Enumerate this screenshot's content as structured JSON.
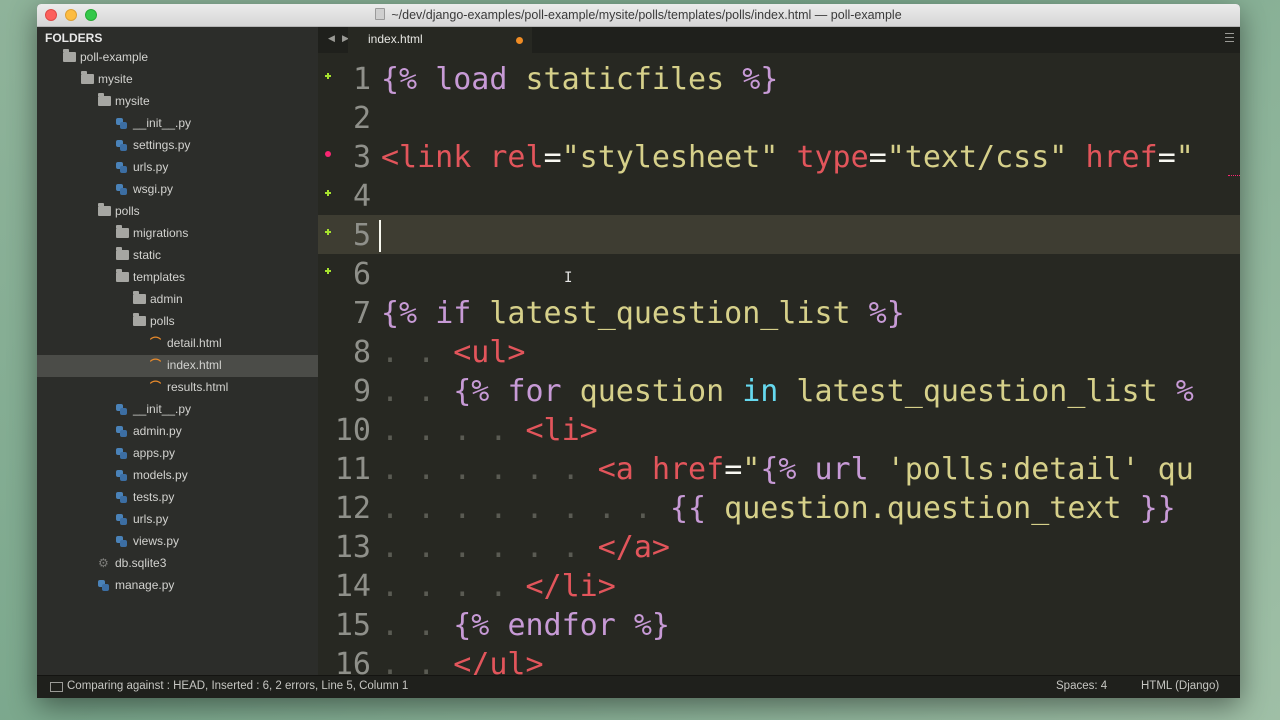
{
  "window": {
    "title": "~/dev/django-examples/poll-example/mysite/polls/templates/polls/index.html — poll-example"
  },
  "sidebar": {
    "header": "FOLDERS",
    "tree": [
      {
        "label": "poll-example",
        "icon": "folder-icon",
        "depth": 0
      },
      {
        "label": "mysite",
        "icon": "folder-icon",
        "depth": 1
      },
      {
        "label": "mysite",
        "icon": "folder-icon",
        "depth": 2
      },
      {
        "label": "__init__.py",
        "icon": "python-file-icon",
        "depth": 3
      },
      {
        "label": "settings.py",
        "icon": "python-file-icon",
        "depth": 3
      },
      {
        "label": "urls.py",
        "icon": "python-file-icon",
        "depth": 3
      },
      {
        "label": "wsgi.py",
        "icon": "python-file-icon",
        "depth": 3
      },
      {
        "label": "polls",
        "icon": "folder-icon",
        "depth": 2
      },
      {
        "label": "migrations",
        "icon": "folder-icon",
        "depth": 3
      },
      {
        "label": "static",
        "icon": "folder-icon",
        "depth": 3
      },
      {
        "label": "templates",
        "icon": "folder-icon",
        "depth": 3
      },
      {
        "label": "admin",
        "icon": "folder-icon",
        "depth": 4
      },
      {
        "label": "polls",
        "icon": "folder-icon",
        "depth": 4
      },
      {
        "label": "detail.html",
        "icon": "html-file-icon",
        "depth": 5
      },
      {
        "label": "index.html",
        "icon": "html-file-icon",
        "depth": 5,
        "selected": true
      },
      {
        "label": "results.html",
        "icon": "html-file-icon",
        "depth": 5
      },
      {
        "label": "__init__.py",
        "icon": "python-file-icon",
        "depth": 3
      },
      {
        "label": "admin.py",
        "icon": "python-file-icon",
        "depth": 3
      },
      {
        "label": "apps.py",
        "icon": "python-file-icon",
        "depth": 3
      },
      {
        "label": "models.py",
        "icon": "python-file-icon",
        "depth": 3
      },
      {
        "label": "tests.py",
        "icon": "python-file-icon",
        "depth": 3
      },
      {
        "label": "urls.py",
        "icon": "python-file-icon",
        "depth": 3
      },
      {
        "label": "views.py",
        "icon": "python-file-icon",
        "depth": 3
      },
      {
        "label": "db.sqlite3",
        "icon": "gear-icon",
        "depth": 2
      },
      {
        "label": "manage.py",
        "icon": "python-file-icon",
        "depth": 2
      }
    ]
  },
  "tabs": [
    {
      "label": "index.html",
      "dirty": true
    }
  ],
  "editor": {
    "current_line": 5,
    "lines": [
      {
        "n": "1",
        "mark": "add",
        "indent": 0,
        "tokens": [
          [
            "t-tmpl",
            "{% "
          ],
          [
            "t-kw",
            "load"
          ],
          [
            "t-str",
            " staticfiles"
          ],
          [
            "t-tmpl",
            " %}"
          ]
        ]
      },
      {
        "n": "2",
        "mark": "",
        "indent": 0,
        "tokens": []
      },
      {
        "n": "3",
        "mark": "err",
        "indent": 0,
        "tokens": [
          [
            "t-tag",
            "<link "
          ],
          [
            "t-attr",
            "rel"
          ],
          [
            "",
            "="
          ],
          [
            "t-str",
            "\"stylesheet\" "
          ],
          [
            "t-attr",
            "type"
          ],
          [
            "",
            "="
          ],
          [
            "t-str",
            "\"text/css\" "
          ],
          [
            "t-attr",
            "href"
          ],
          [
            "",
            "="
          ],
          [
            "t-str",
            "\""
          ]
        ]
      },
      {
        "n": "4",
        "mark": "add",
        "indent": 0,
        "tokens": []
      },
      {
        "n": "5",
        "mark": "add",
        "indent": 0,
        "tokens": []
      },
      {
        "n": "6",
        "mark": "add",
        "indent": 0,
        "tokens": []
      },
      {
        "n": "7",
        "mark": "",
        "indent": 0,
        "tokens": [
          [
            "t-tmpl",
            "{% "
          ],
          [
            "t-kw",
            "if"
          ],
          [
            "t-var",
            " latest_question_list"
          ],
          [
            "t-tmpl",
            " %}"
          ]
        ]
      },
      {
        "n": "8",
        "mark": "",
        "indent": 1,
        "tokens": [
          [
            "t-tag",
            "<ul>"
          ]
        ]
      },
      {
        "n": "9",
        "mark": "",
        "indent": 1,
        "tokens": [
          [
            "t-tmpl",
            "{% "
          ],
          [
            "t-kw",
            "for"
          ],
          [
            "t-var",
            " question "
          ],
          [
            "t-op",
            "in"
          ],
          [
            "t-var",
            " latest_question_list "
          ],
          [
            "t-tmpl",
            "%"
          ]
        ]
      },
      {
        "n": "10",
        "mark": "",
        "indent": 2,
        "tokens": [
          [
            "t-tag",
            "<li>"
          ]
        ]
      },
      {
        "n": "11",
        "mark": "",
        "indent": 3,
        "tokens": [
          [
            "t-tag",
            "<a "
          ],
          [
            "t-attr",
            "href"
          ],
          [
            "",
            "="
          ],
          [
            "t-str",
            "\""
          ],
          [
            "t-tmpl",
            "{% "
          ],
          [
            "t-kw",
            "url"
          ],
          [
            "t-str",
            " 'polls:detail' qu"
          ]
        ]
      },
      {
        "n": "12",
        "mark": "",
        "indent": 4,
        "tokens": [
          [
            "t-tmpl",
            "{{ "
          ],
          [
            "t-var",
            "question.question_text"
          ],
          [
            "t-tmpl",
            " }}"
          ]
        ]
      },
      {
        "n": "13",
        "mark": "",
        "indent": 3,
        "tokens": [
          [
            "t-tag",
            "</a>"
          ]
        ]
      },
      {
        "n": "14",
        "mark": "",
        "indent": 2,
        "tokens": [
          [
            "t-tag",
            "</li>"
          ]
        ]
      },
      {
        "n": "15",
        "mark": "",
        "indent": 1,
        "tokens": [
          [
            "t-tmpl",
            "{% "
          ],
          [
            "t-kw",
            "endfor"
          ],
          [
            "t-tmpl",
            " %}"
          ]
        ]
      },
      {
        "n": "16",
        "mark": "",
        "indent": 1,
        "tokens": [
          [
            "t-tag",
            "</ul>"
          ]
        ]
      }
    ]
  },
  "statusbar": {
    "left": "Comparing against : HEAD, Inserted : 6, 2 errors, Line 5, Column 1",
    "spaces": "Spaces: 4",
    "syntax": "HTML (Django)"
  },
  "colors": {
    "editor_bg": "#272822",
    "sidebar_bg": "#2c2d2a",
    "tag": "#e2555b",
    "template": "#c79ad6",
    "string": "#d6d08a",
    "gutter_add": "#a6e22e",
    "gutter_error": "#f92672",
    "tab_dirty": "#f08c24"
  }
}
